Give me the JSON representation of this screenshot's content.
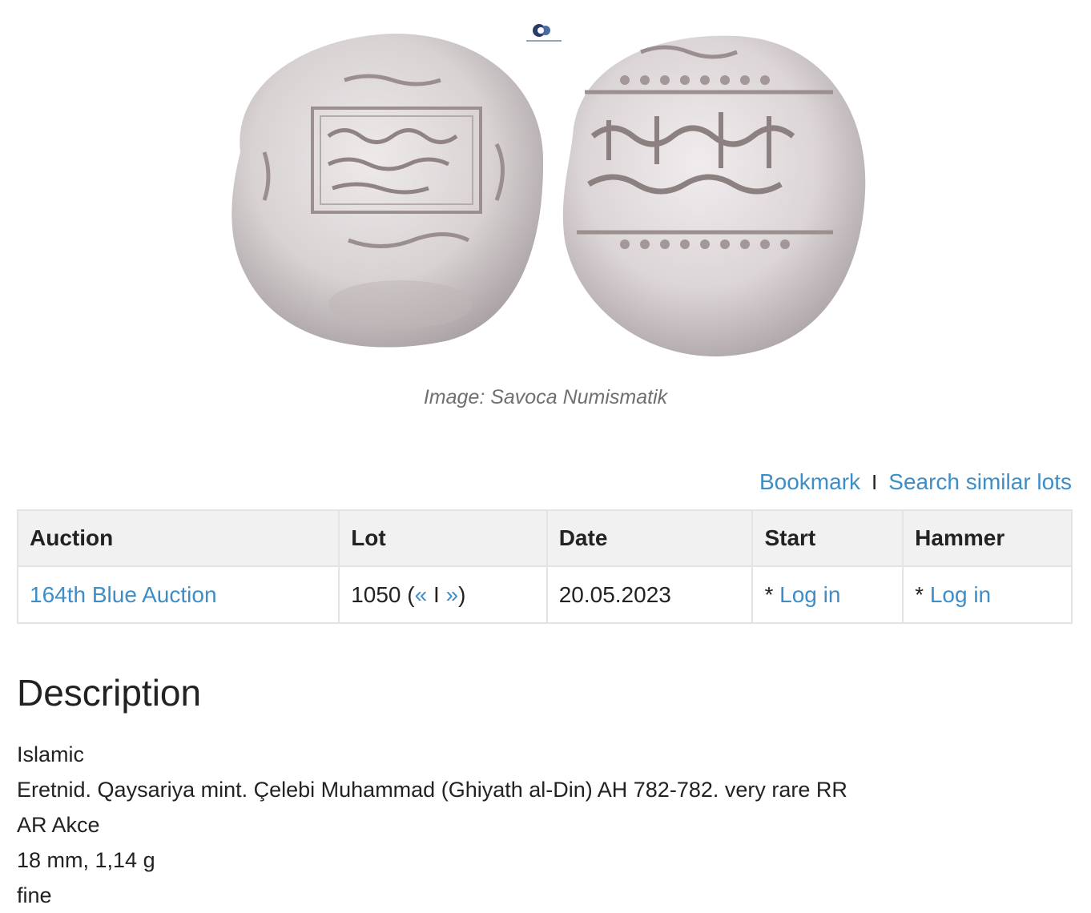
{
  "figure": {
    "caption": "Image: Savoca Numismatik",
    "alt": "Silver coin obverse and reverse"
  },
  "actions": {
    "bookmark": "Bookmark",
    "separator": "I",
    "search_similar": "Search similar lots"
  },
  "table": {
    "headers": [
      "Auction",
      "Lot",
      "Date",
      "Start",
      "Hammer"
    ],
    "row": {
      "auction": "164th Blue Auction",
      "lot_number": "1050 (",
      "lot_prev": "«",
      "lot_sep": " I ",
      "lot_next": "»",
      "lot_close": ")",
      "date": "20.05.2023",
      "start_prefix": "* ",
      "start_link": "Log in",
      "hammer_prefix": "* ",
      "hammer_link": "Log in"
    }
  },
  "description": {
    "title": "Description",
    "lines": [
      "Islamic",
      "Eretnid. Qaysariya mint. Çelebi Muhammad (Ghiyath al-Din) AH 782-782. very rare RR",
      "AR Akce",
      "18 mm, 1,14 g",
      "fine"
    ]
  },
  "colors": {
    "link": "#3d8ec7",
    "header_bg": "#f1f1f1",
    "border": "#e3e3e3",
    "caption": "#6f6f6f"
  }
}
